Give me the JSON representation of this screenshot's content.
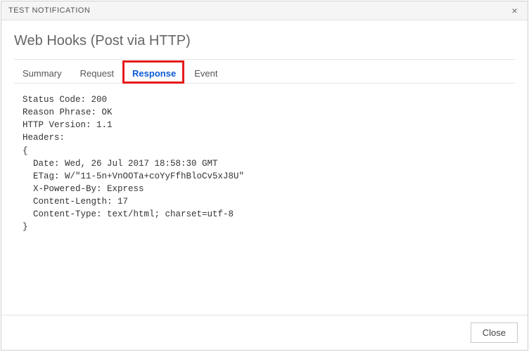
{
  "window": {
    "title": "TEST NOTIFICATION",
    "close_glyph": "×"
  },
  "heading": "Web Hooks (Post via HTTP)",
  "tabs": {
    "summary": "Summary",
    "request": "Request",
    "response": "Response",
    "event": "Event",
    "active": "response"
  },
  "response": {
    "lines": [
      "Status Code: 200",
      "Reason Phrase: OK",
      "HTTP Version: 1.1",
      "Headers:",
      "{",
      "  Date: Wed, 26 Jul 2017 18:58:30 GMT",
      "  ETag: W/\"11-5n+VnOOTa+coYyFfhBloCv5xJ8U\"",
      "  X-Powered-By: Express",
      "  Content-Length: 17",
      "  Content-Type: text/html; charset=utf-8",
      "}"
    ]
  },
  "footer": {
    "close_label": "Close"
  }
}
